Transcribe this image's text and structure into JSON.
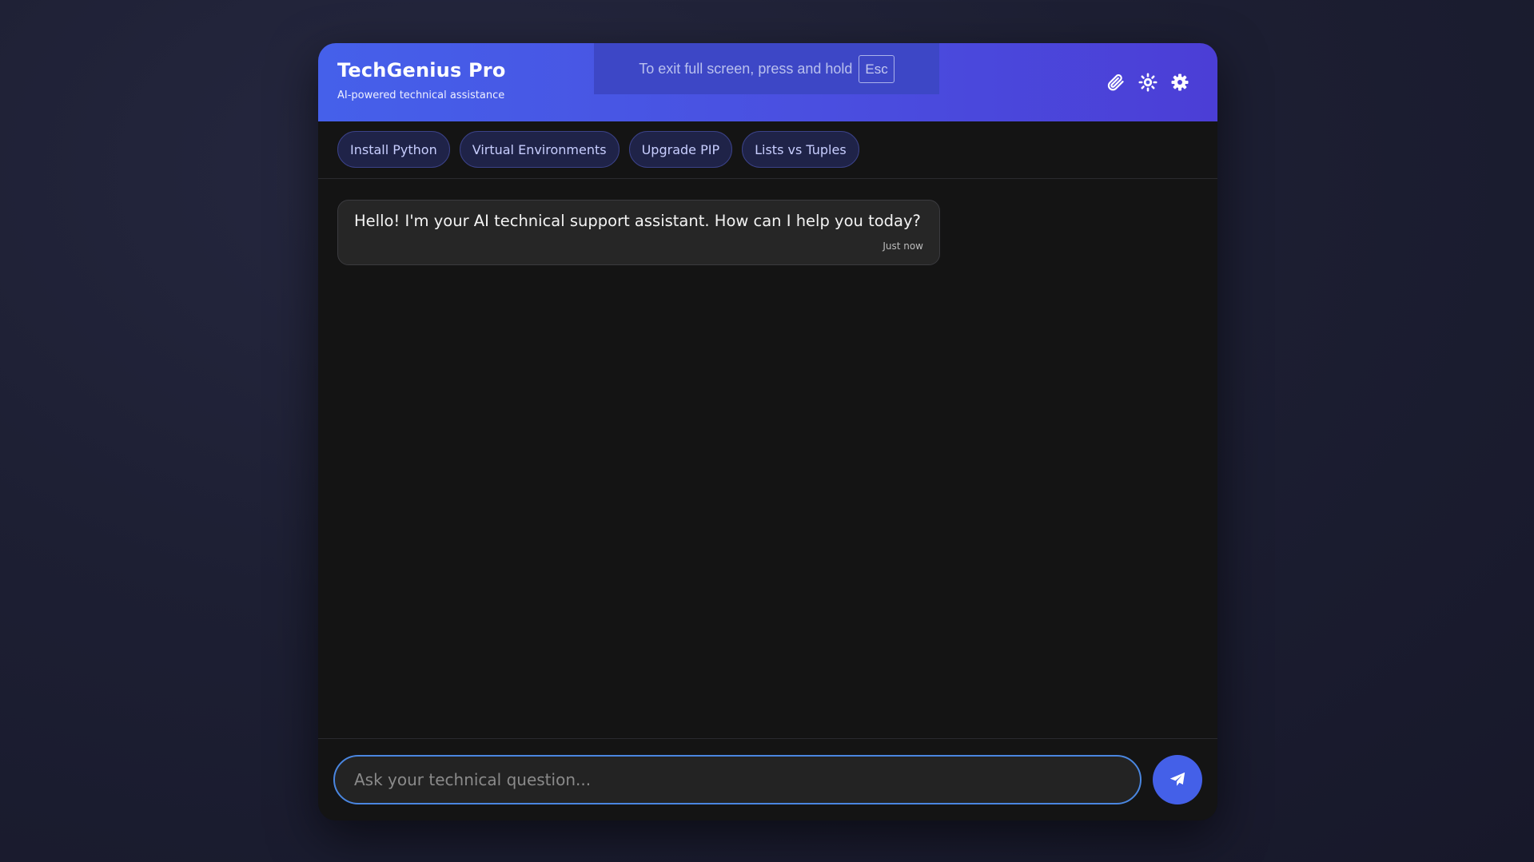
{
  "header": {
    "title": "TechGenius Pro",
    "subtitle": "AI-powered technical assistance",
    "icons": [
      "paperclip-icon",
      "sun-icon",
      "gear-icon"
    ]
  },
  "fullscreen_notice": {
    "text": "To exit full screen, press and hold",
    "key": "Esc"
  },
  "suggestions": [
    "Install Python",
    "Virtual Environments",
    "Upgrade PIP",
    "Lists vs Tuples"
  ],
  "messages": [
    {
      "sender": "assistant",
      "text": "Hello! I'm your AI technical support assistant. How can I help you today?",
      "time": "Just now"
    }
  ],
  "composer": {
    "placeholder": "Ask your technical question...",
    "value": ""
  },
  "colors": {
    "header_gradient_start": "#4560ea",
    "header_gradient_end": "#4b3ed6",
    "panel_bg": "#141414",
    "accent": "#4460e8",
    "input_border": "#4a86e0"
  }
}
